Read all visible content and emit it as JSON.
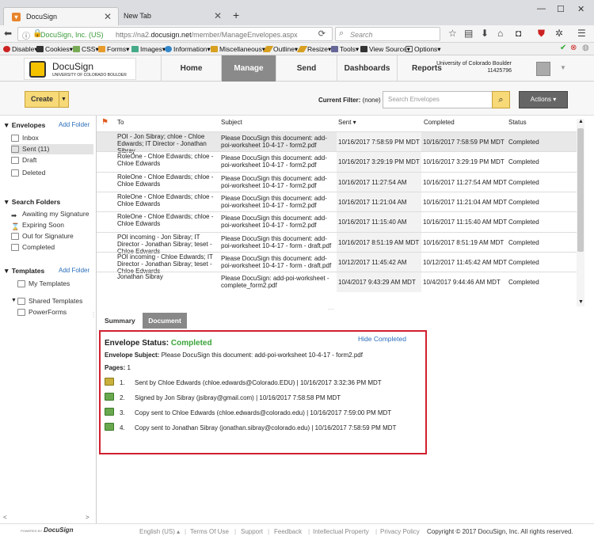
{
  "browser": {
    "tabs": [
      {
        "title": "DocuSign",
        "active": true
      },
      {
        "title": "New Tab",
        "active": false
      }
    ],
    "new_tab_symbol": "+",
    "url_org": "DocuSign, Inc. (US)",
    "url_prefix": "https://na2.",
    "url_host": "docusign.net",
    "url_path": "/member/ManageEnvelopes.aspx",
    "search_placeholder": "Search",
    "webdev_toolbar": [
      "Disable▾",
      "Cookies▾",
      "CSS▾",
      "Forms▾",
      "Images▾",
      "Information▾",
      "Miscellaneous▾",
      "Outline▾",
      "Resize▾",
      "Tools▾",
      "View Source▾",
      "Options▾"
    ]
  },
  "header": {
    "logo_name": "DocuSign",
    "logo_univ": "UNIVERSITY OF COLORADO BOULDER",
    "nav": [
      "Home",
      "Manage",
      "Send",
      "Dashboards",
      "Reports"
    ],
    "active_nav": "Manage",
    "account_name": "University of Colorado Boulder",
    "account_id": "11425796"
  },
  "toolbar": {
    "create_label": "Create",
    "filter_label": "Current Filter:",
    "filter_value": "(none)",
    "search_placeholder": "Search Envelopes",
    "actions_label": "Actions"
  },
  "sidebar": {
    "envelopes_title": "Envelopes",
    "add_folder": "Add Folder",
    "envelope_items": [
      "Inbox",
      "Sent (11)",
      "Draft",
      "Deleted"
    ],
    "search_title": "Search Folders",
    "search_items": [
      "Awaiting my Signature",
      "Expiring Soon",
      "Out for Signature",
      "Completed"
    ],
    "templates_title": "Templates",
    "template_items": [
      "My Templates",
      "Shared Templates",
      "PowerForms"
    ]
  },
  "list": {
    "headers": {
      "to": "To",
      "subject": "Subject",
      "sent": "Sent ▾",
      "completed": "Completed",
      "status": "Status"
    },
    "rows": [
      {
        "to": "POI - Jon Sibray; chloe - Chloe Edwards; IT Director - Jonathan Sibray",
        "subject": "Please DocuSign this document: add-poi-worksheet 10-4-17 - form2.pdf",
        "sent": "10/16/2017 7:58:59 PM MDT",
        "completed": "10/16/2017 7:58:59 PM MDT",
        "status": "Completed",
        "selected": true
      },
      {
        "to": "RoleOne - Chloe Edwards; chloe - Chloe Edwards",
        "subject": "Please DocuSign this document: add-poi-worksheet 10-4-17 - form2.pdf",
        "sent": "10/16/2017 3:29:19 PM MDT",
        "completed": "10/16/2017 3:29:19 PM MDT",
        "status": "Completed"
      },
      {
        "to": "RoleOne - Chloe Edwards; chloe - Chloe Edwards",
        "subject": "Please DocuSign this document: add-poi-worksheet 10-4-17 - form2.pdf",
        "sent": "10/16/2017 11:27:54 AM MDT",
        "completed": "10/16/2017 11:27:54 AM MDT",
        "status": "Completed"
      },
      {
        "to": "RoleOne - Chloe Edwards; chloe - Chloe Edwards",
        "subject": "Please DocuSign this document: add-poi-worksheet 10-4-17 - form2.pdf",
        "sent": "10/16/2017 11:21:04 AM MDT",
        "completed": "10/16/2017 11:21:04 AM MDT",
        "status": "Completed"
      },
      {
        "to": "RoleOne - Chloe Edwards; chloe - Chloe Edwards",
        "subject": "Please DocuSign this document: add-poi-worksheet 10-4-17 - form2.pdf",
        "sent": "10/16/2017 11:15:40 AM MDT",
        "completed": "10/16/2017 11:15:40 AM MDT",
        "status": "Completed"
      },
      {
        "to": "POI incoming - Jon Sibray; IT Director - Jonathan Sibray; teset - Chloe Edwards",
        "subject": "Please DocuSign this document: add-poi-worksheet 10-4-17 - form - draft.pdf",
        "sent": "10/16/2017 8:51:19 AM MDT",
        "completed": "10/16/2017 8:51:19 AM MDT",
        "status": "Completed"
      },
      {
        "to": "POI incoming - Chloe Edwards; IT Director - Jonathan Sibray; teset - Chloe Edwards",
        "subject": "Please DocuSign this document: add-poi-worksheet 10-4-17 - form - draft.pdf",
        "sent": "10/12/2017 11:45:42 AM MDT",
        "completed": "10/12/2017 11:45:42 AM MDT",
        "status": "Completed"
      },
      {
        "to": "Jonathan Sibray",
        "subject": "Please DocuSign: add-poi-worksheet - complete_form2.pdf",
        "sent": "10/4/2017 9:43:29 AM MDT",
        "completed": "10/4/2017 9:44:46 AM MDT",
        "status": "Completed"
      }
    ]
  },
  "details": {
    "tab_summary": "Summary",
    "tab_document": "Document",
    "hide_completed": "Hide Completed",
    "status_label": "Envelope Status:",
    "status_value": "Completed",
    "subject_label": "Envelope Subject:",
    "subject_value": "Please DocuSign this document: add-poi-worksheet 10-4-17 - form2.pdf",
    "pages_label": "Pages:",
    "pages_value": "1",
    "history": [
      {
        "num": "1.",
        "text": "Sent by Chloe Edwards (chloe.edwards@Colorado.EDU) | 10/16/2017 3:32:36 PM MDT",
        "icon": "sent-icon"
      },
      {
        "num": "2.",
        "text": "Signed by Jon Sibray (jsibray@gmail.com) | 10/16/2017 7:58:58 PM MDT",
        "icon": "signed-icon"
      },
      {
        "num": "3.",
        "text": "Copy sent to Chloe Edwards (chloe.edwards@colorado.edu) | 10/16/2017 7:59:00 PM MDT",
        "icon": "copy-icon"
      },
      {
        "num": "4.",
        "text": "Copy sent to Jonathan Sibray (jonathan.sibray@colorado.edu) | 10/16/2017 7:58:59 PM MDT",
        "icon": "copy-icon"
      }
    ]
  },
  "footer": {
    "powered_by": "POWERED BY",
    "powered_brand": "DocuSign",
    "links": [
      "English (US) ▴",
      "Terms Of Use",
      "Support",
      "Feedback",
      "Intellectual Property",
      "Privacy Policy"
    ],
    "copyright": "Copyright © 2017 DocuSign, Inc. All rights reserved."
  }
}
